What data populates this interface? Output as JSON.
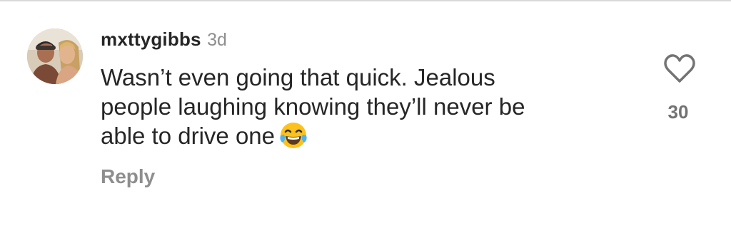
{
  "comment": {
    "username": "mxttygibbs",
    "timestamp": "3d",
    "text_lines": [
      "Wasn’t even going that quick. Jealous",
      "people laughing knowing they’ll never be",
      "able to drive one"
    ],
    "emoji": "face-with-tears-of-joy",
    "reply_label": "Reply",
    "like_count": "30"
  },
  "colors": {
    "primary_text": "#262626",
    "secondary_text": "#8e8e8e",
    "like_count_text": "#737373",
    "emoji_face": "#fcc21b"
  },
  "icons": {
    "like": "heart-outline-icon",
    "emoji": "laughing-tears-emoji-icon"
  }
}
